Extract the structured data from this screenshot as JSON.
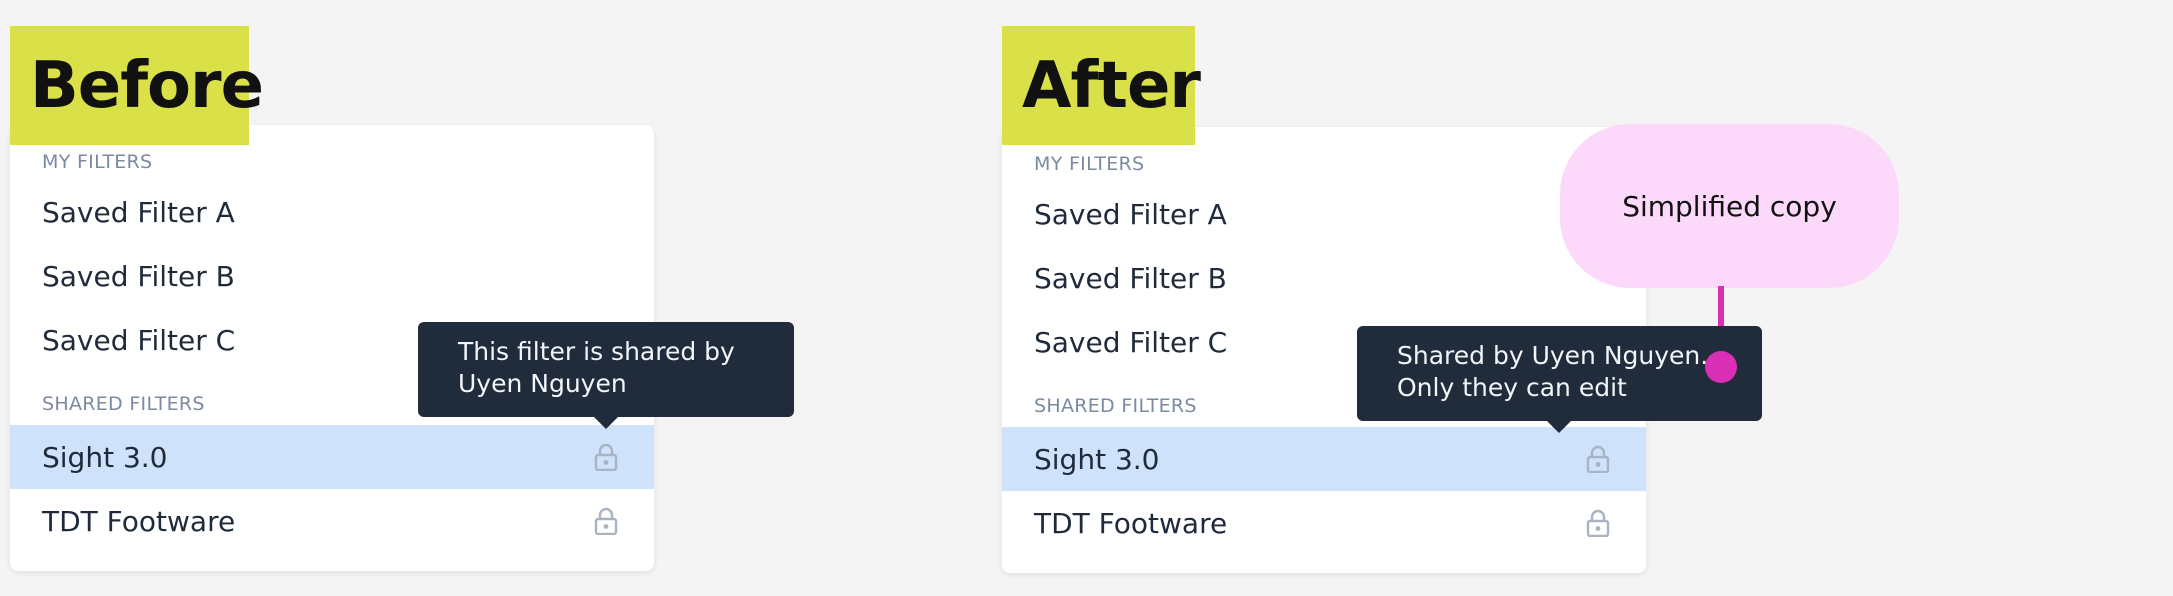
{
  "before": {
    "heading": "Before",
    "my_filters_label": "MY FILTERS",
    "my_filters": [
      "Saved Filter A",
      "Saved Filter B",
      "Saved Filter C"
    ],
    "shared_filters_label": "SHARED FILTERS",
    "shared_filters": [
      "Sight 3.0",
      "TDT Footware"
    ],
    "tooltip": [
      "This filter is shared by",
      "Uyen Nguyen"
    ]
  },
  "after": {
    "heading": "After",
    "my_filters_label": "MY FILTERS",
    "my_filters": [
      "Saved Filter A",
      "Saved Filter B",
      "Saved Filter C"
    ],
    "shared_filters_label": "SHARED FILTERS",
    "shared_filters": [
      "Sight 3.0",
      "TDT Footware"
    ],
    "tooltip": [
      "Shared by Uyen Nguyen.",
      "Only they can edit"
    ],
    "annotation": "Simplified copy"
  },
  "colors": {
    "tag": "#d9e048",
    "selected_row": "#cfe2fb",
    "tooltip_bg": "#202c3c",
    "callout_bg": "#fcd8fa",
    "callout_accent": "#d82fb4"
  },
  "icons": {
    "lock": "lock-icon"
  }
}
